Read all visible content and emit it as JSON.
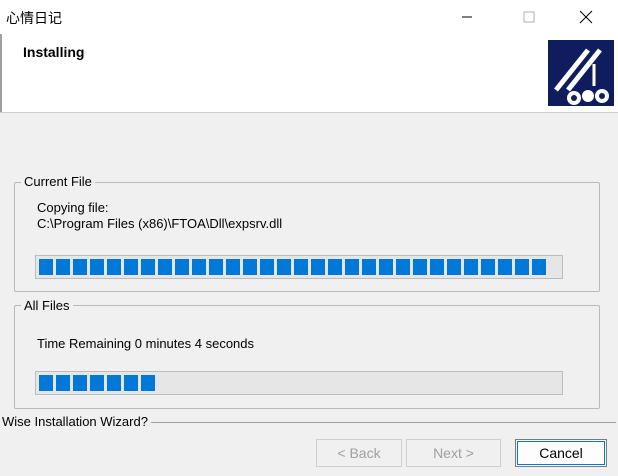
{
  "window": {
    "title": "心情日记",
    "minimize_icon": "minimize-icon",
    "maximize_icon": "maximize-icon",
    "close_icon": "close-icon"
  },
  "header": {
    "title": "Installing",
    "logo_icon": "installer-logo-icon"
  },
  "current_file": {
    "legend": "Current File",
    "copying_label": "Copying file:",
    "file_path": "C:\\Program Files (x86)\\FTOA\\Dll\\expsrv.dll",
    "progress": 1.0
  },
  "all_files": {
    "legend": "All Files",
    "time_remaining": "Time Remaining 0 minutes 4 seconds",
    "progress": 0.22
  },
  "footer": {
    "wizard_label": "Wise Installation Wizard?",
    "back_label": "< Back",
    "next_label": "Next >",
    "cancel_label": "Cancel"
  },
  "colors": {
    "accent": "#0078d7",
    "logo_bg": "#0f1d5e"
  }
}
